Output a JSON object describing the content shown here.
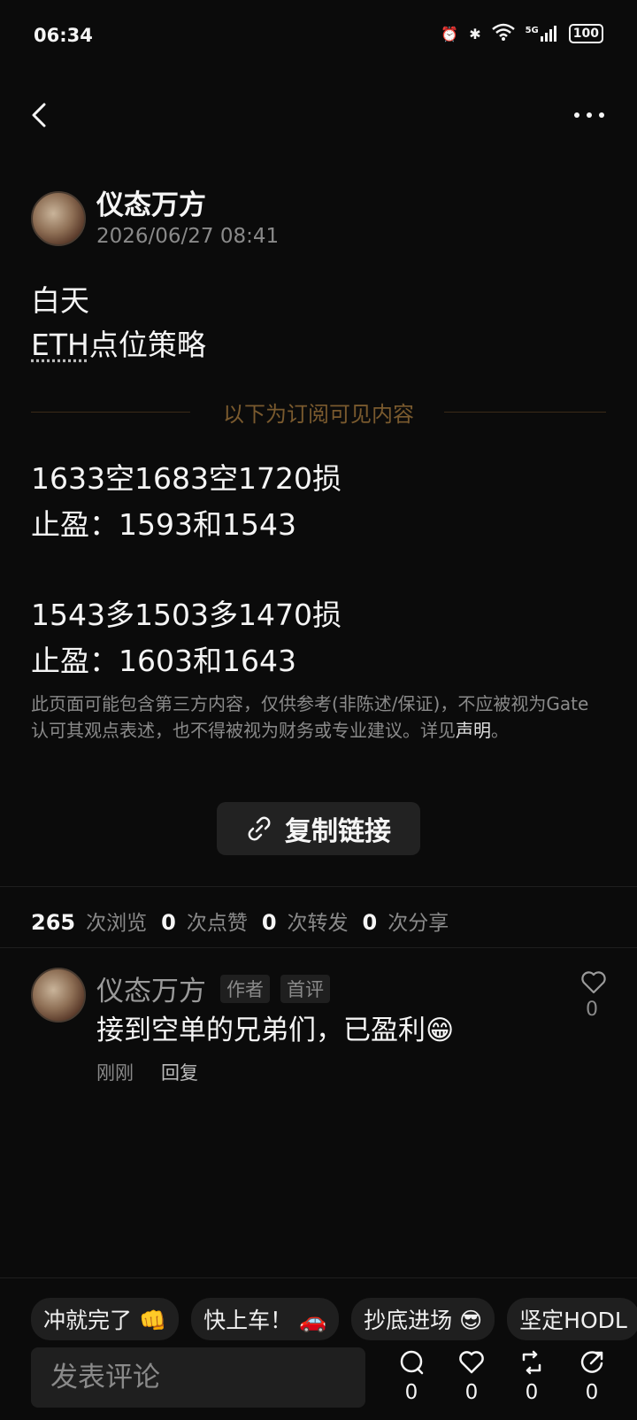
{
  "status_bar": {
    "time": "06:34",
    "network": "5G",
    "battery": "100"
  },
  "post": {
    "author": "仪态万方",
    "time": "2026/06/27 08:41",
    "line1": "白天",
    "eth_token": "ETH",
    "line2_rest": "点位策略",
    "divider_text": "以下为订阅可见内容",
    "short_entry": "1633空1683空1720损",
    "short_tp": "止盈：1593和1543",
    "long_entry": "1543多1503多1470损",
    "long_tp": "止盈：1603和1643",
    "disclaimer_pre": "此页面可能包含第三方内容，仅供参考(非陈述/保证)，不应被视为Gate认可其观点表述，也不得被视为财务或专业建议。详见",
    "disclaimer_link": "声明",
    "disclaimer_end": "。",
    "copy_link": "复制链接"
  },
  "stats": {
    "views": "265",
    "views_label": "次浏览",
    "likes": "0",
    "likes_label": "次点赞",
    "reposts": "0",
    "reposts_label": "次转发",
    "shares": "0",
    "shares_label": "次分享"
  },
  "comment": {
    "author": "仪态万方",
    "tag_author": "作者",
    "tag_first": "首评",
    "text": "接到空单的兄弟们，已盈利😁",
    "time": "刚刚",
    "reply": "回复",
    "like_count": "0"
  },
  "quick_replies": [
    "冲就完了 👊",
    "快上车！ 🚗",
    "抄底进场 😎",
    "坚定HODL"
  ],
  "bottom_bar": {
    "placeholder": "发表评论",
    "comment_count": "0",
    "like_count": "0",
    "repost_count": "0",
    "share_count": "0"
  },
  "colors": {
    "background": "#0b0b0b",
    "divider_text": "#7a5a2e",
    "muted": "#8a8a8a"
  },
  "icons": [
    "back-icon",
    "more-icon",
    "link-icon",
    "heart-icon",
    "comment-icon",
    "repost-icon",
    "share-icon"
  ]
}
